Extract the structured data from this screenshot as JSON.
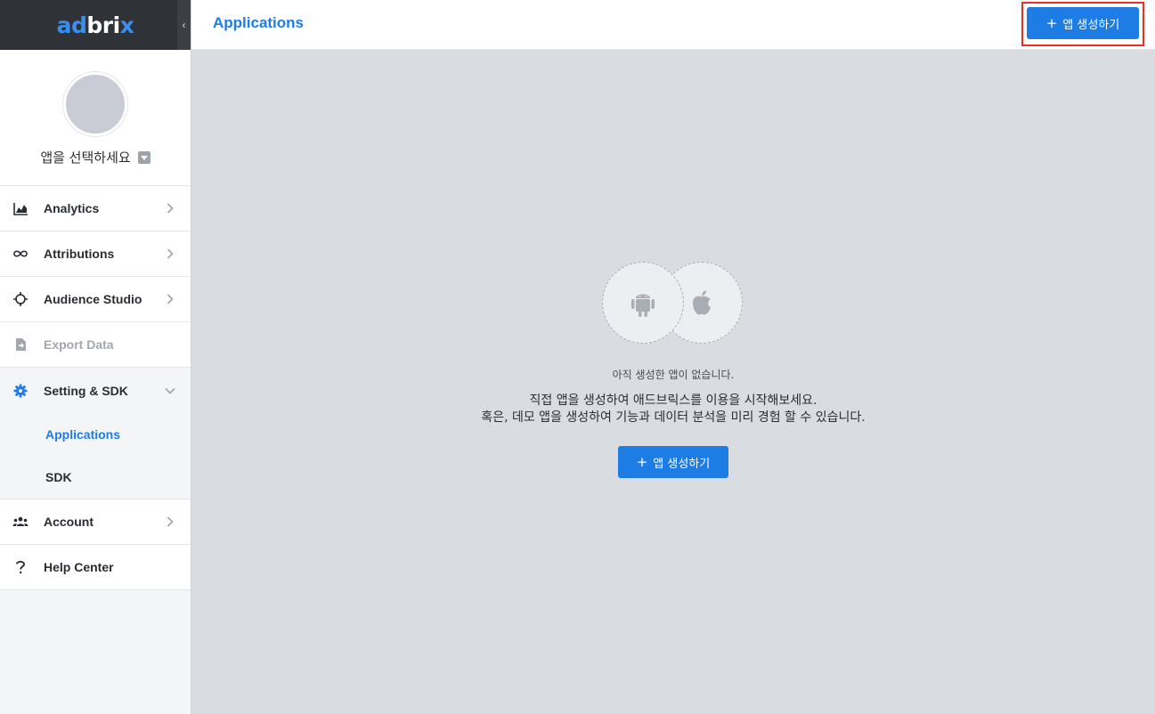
{
  "brand": {
    "logo_ad": "ad",
    "logo_bri": "bri",
    "logo_x": "x",
    "collapse_glyph": "‹"
  },
  "app_selector": {
    "placeholder": "앱을 선택하세요"
  },
  "nav": {
    "analytics": "Analytics",
    "attributions": "Attributions",
    "audience_studio": "Audience Studio",
    "export_data": "Export Data",
    "setting_sdk": "Setting & SDK",
    "sub_applications": "Applications",
    "sub_sdk": "SDK",
    "account": "Account",
    "help_center": "Help Center"
  },
  "header": {
    "title": "Applications",
    "create_label": "앱 생성하기",
    "plus": "+"
  },
  "empty_state": {
    "title": "아직 생성한 앱이 없습니다.",
    "line1": "직접 앱을 생성하여 애드브릭스를 이용을 시작해보세요.",
    "line2": "혹은, 데모 앱을 생성하여 기능과 데이터 분석을 미리 경험 할 수 있습니다.",
    "create_label": "앱 생성하기",
    "plus": "+"
  },
  "colors": {
    "accent": "#1e7ce5",
    "highlight_border": "#e8311f",
    "sidebar_dark": "#2f3237",
    "page_bg": "#d9dde2"
  },
  "icons": {
    "analytics": "area-chart-icon",
    "attributions": "infinity-icon",
    "audience_studio": "crosshair-icon",
    "export_data": "file-export-icon",
    "setting_sdk": "gear-icon",
    "account": "users-icon",
    "help_center": "question-icon",
    "empty_left": "android-icon",
    "empty_right": "apple-icon"
  }
}
